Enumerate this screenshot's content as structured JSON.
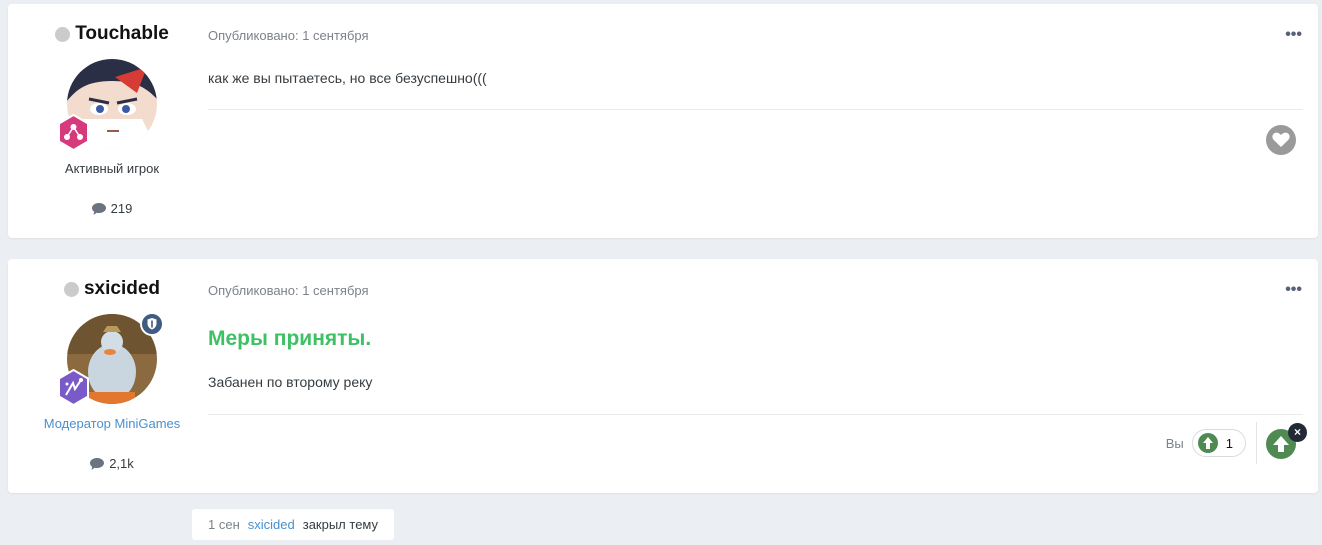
{
  "posts": [
    {
      "author": "Touchable",
      "role": "Активный игрок",
      "post_count": "219",
      "meta": "Опубликовано: 1 сентября",
      "text": "как же вы пытаетесь, но все безуспешно((("
    },
    {
      "author": "sxicided",
      "role": "Модератор MiniGames",
      "post_count": "2,1k",
      "meta": "Опубликовано: 1 сентября",
      "headline": "Меры приняты.",
      "text": "Забанен по второму реку",
      "reaction_label": "Вы",
      "reaction_count": "1"
    }
  ],
  "event": {
    "date": "1 сен",
    "user": "sxicided",
    "action": "закрыл тему"
  },
  "ui": {
    "more_glyph": "•••",
    "close_glyph": "×"
  },
  "colors": {
    "accent_green": "#3ec164",
    "link_blue": "#4a8fd0",
    "upvote_green": "#4e8a52",
    "heart_gray": "#9a9a9a"
  },
  "icons": [
    "status-dot-icon",
    "comment-icon",
    "more-options-icon",
    "heart-icon",
    "upvote-icon",
    "close-icon",
    "moderator-shield-icon",
    "rank-badge-icon"
  ]
}
